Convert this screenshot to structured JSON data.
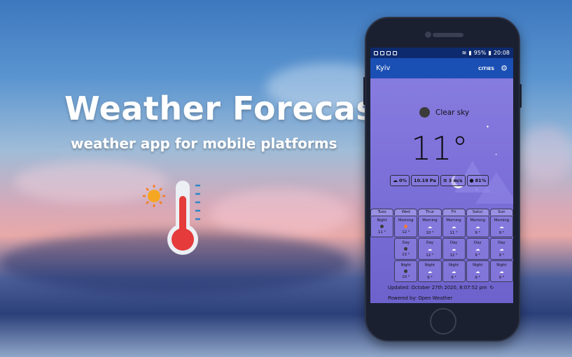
{
  "promo": {
    "title": "Weather Forecast",
    "subtitle": "weather app for mobile platforms"
  },
  "status_bar": {
    "battery": "95%",
    "time": "20:08"
  },
  "app_bar": {
    "city": "Kyiv",
    "cities_label": "CITIES",
    "settings_icon": "gear-icon"
  },
  "current": {
    "condition": "Clear sky",
    "temperature": "11°",
    "cloudiness": "0%",
    "pressure": "10.19 Pa",
    "wind": "3 m/s",
    "humidity": "81%"
  },
  "forecast": {
    "days": [
      "Tues",
      "Wed",
      "Thur",
      "Fri",
      "Satur",
      "Sun"
    ],
    "rows": [
      [
        {
          "period": "Night",
          "temp": "11 °",
          "icon": "dark-circle"
        },
        {
          "period": "Morning",
          "temp": "12 °",
          "icon": "sun"
        },
        {
          "period": "Morning",
          "temp": "10 °",
          "icon": "cloud"
        },
        {
          "period": "Morning",
          "temp": "11 °",
          "icon": "cloud"
        },
        {
          "period": "Morning",
          "temp": "9 °",
          "icon": "cloud"
        },
        {
          "period": "Morning",
          "temp": "9 °",
          "icon": "cloud"
        }
      ],
      [
        null,
        {
          "period": "Day",
          "temp": "13 °",
          "icon": "dark-circle"
        },
        {
          "period": "Day",
          "temp": "12 °",
          "icon": "cloud"
        },
        {
          "period": "Day",
          "temp": "12 °",
          "icon": "cloud"
        },
        {
          "period": "Day",
          "temp": "9 °",
          "icon": "cloud"
        },
        {
          "period": "Day",
          "temp": "9 °",
          "icon": "cloud"
        }
      ],
      [
        null,
        {
          "period": "Night",
          "temp": "10 °",
          "icon": "dark-circle"
        },
        {
          "period": "Night",
          "temp": "9 °",
          "icon": "cloud"
        },
        {
          "period": "Night",
          "temp": "9 °",
          "icon": "cloud"
        },
        {
          "period": "Night",
          "temp": "9 °",
          "icon": "cloud"
        },
        {
          "period": "Night",
          "temp": "9 °",
          "icon": "cloud"
        }
      ]
    ]
  },
  "footer": {
    "updated": "Updated: October 27th 2020, 8:07:52 pm",
    "powered_by": "Powered by: Open Weather"
  },
  "colors": {
    "status_bar": "#0d2a6e",
    "app_bar": "#1a4fb4",
    "screen_bg": "#7b6fd8",
    "sun": "#f5a623",
    "thermometer_red": "#e53b3b"
  }
}
